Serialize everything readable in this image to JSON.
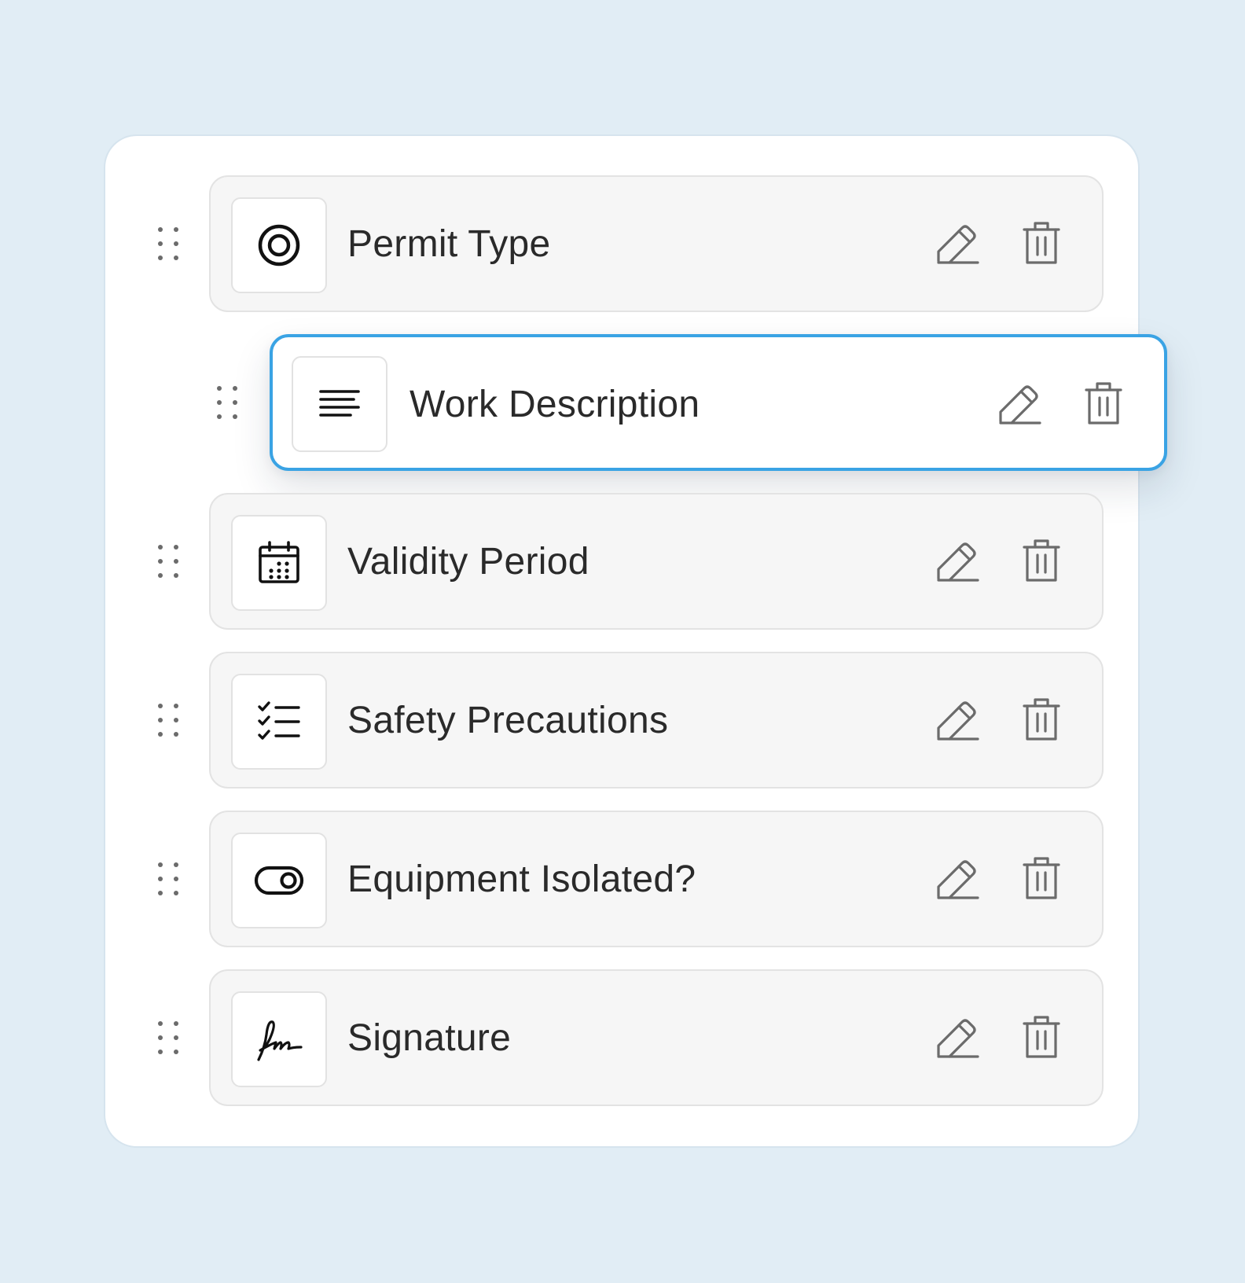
{
  "fields": [
    {
      "label": "Permit Type",
      "icon": "radio-icon",
      "state": "idle"
    },
    {
      "label": "Work Description",
      "icon": "text-lines-icon",
      "state": "dragging"
    },
    {
      "label": "Validity Period",
      "icon": "calendar-icon",
      "state": "idle"
    },
    {
      "label": "Safety Precautions",
      "icon": "checklist-icon",
      "state": "idle"
    },
    {
      "label": "Equipment Isolated?",
      "icon": "toggle-icon",
      "state": "idle"
    },
    {
      "label": "Signature",
      "icon": "signature-icon",
      "state": "idle"
    }
  ],
  "colors": {
    "background": "#e1edf5",
    "panel": "#ffffff",
    "card": "#f6f6f6",
    "drag_accent": "#3aa3e4",
    "text": "#2a2a2a",
    "action_icon": "#6b6b6b"
  }
}
